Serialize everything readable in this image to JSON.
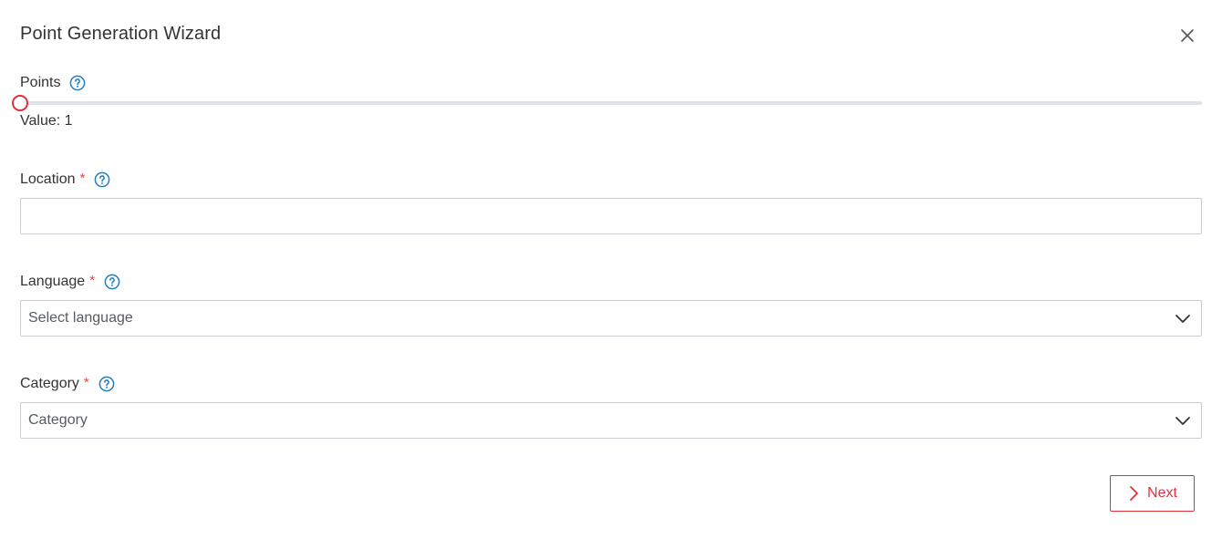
{
  "dialog": {
    "title": "Point Generation Wizard",
    "close_icon": "close-icon"
  },
  "points": {
    "label": "Points",
    "help_icon": "help-circle-icon",
    "slider": {
      "value": 1,
      "fraction": 0
    },
    "value_text": "Value: 1"
  },
  "location": {
    "label": "Location",
    "required_mark": "*",
    "help_icon": "help-circle-icon",
    "value": ""
  },
  "language": {
    "label": "Language",
    "required_mark": "*",
    "help_icon": "help-circle-icon",
    "placeholder": "Select language",
    "chevron_icon": "chevron-down-icon"
  },
  "category": {
    "label": "Category",
    "required_mark": "*",
    "help_icon": "help-circle-icon",
    "placeholder": "Category",
    "chevron_icon": "chevron-down-icon"
  },
  "footer": {
    "next_label": "Next",
    "next_icon": "chevron-right-icon"
  },
  "colors": {
    "accent": "#e0303a",
    "help": "#1f7fc0",
    "required": "#e04848",
    "border": "#c9ced4",
    "track": "#dfe3e8"
  }
}
